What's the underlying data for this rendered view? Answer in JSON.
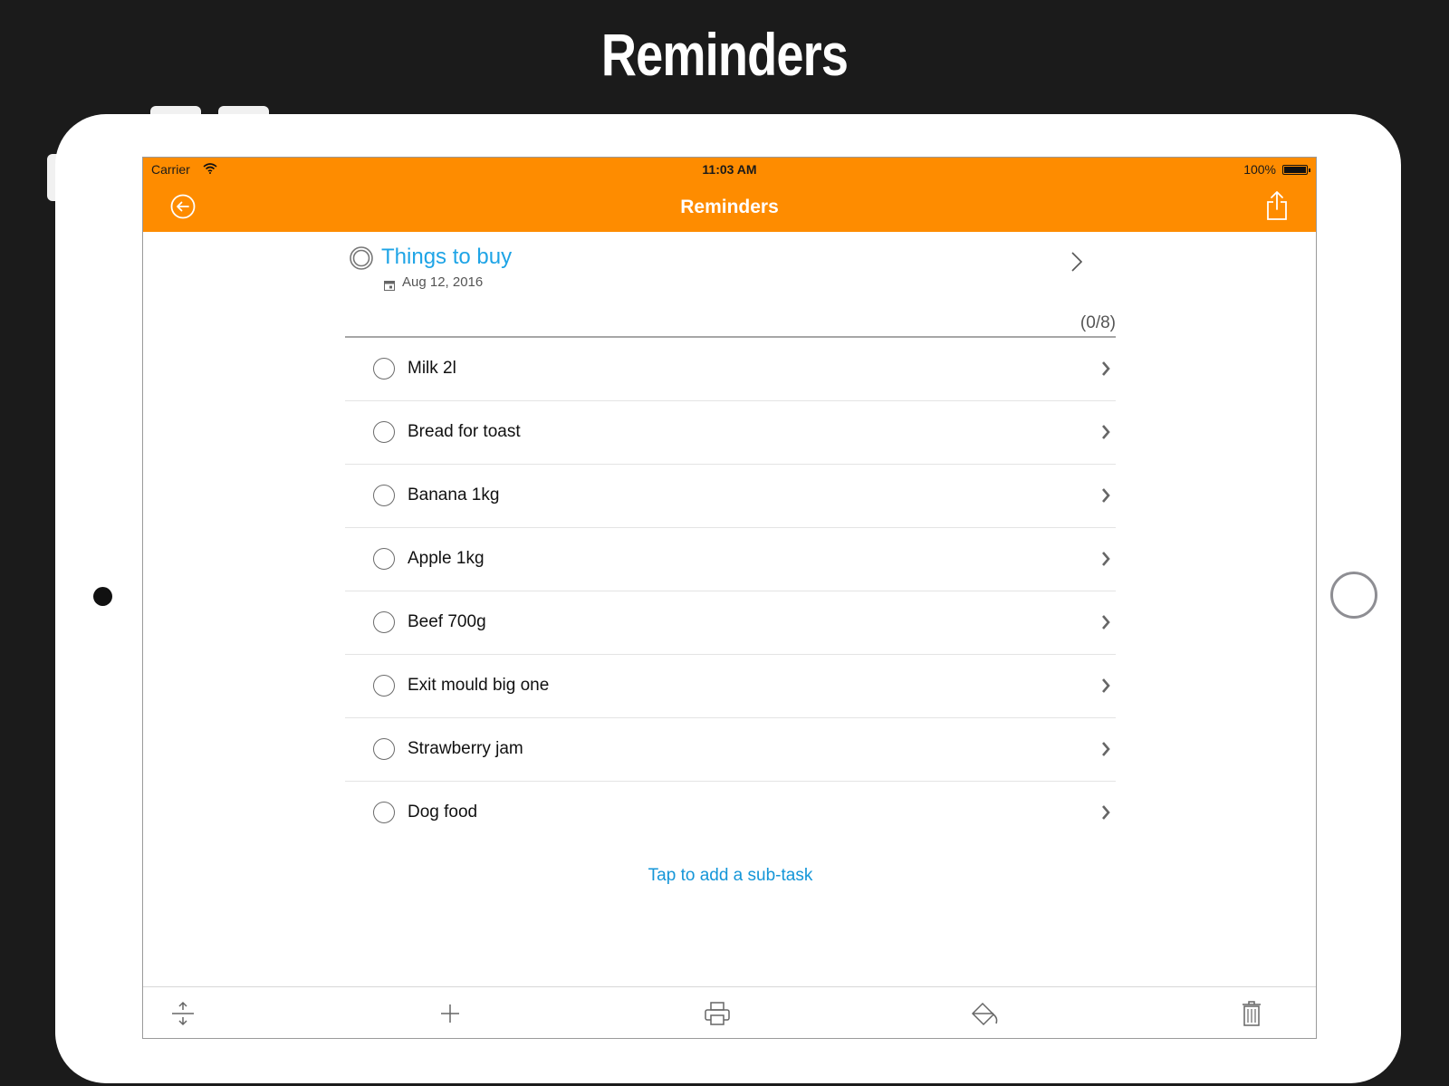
{
  "promo": {
    "title": "Reminders"
  },
  "status_bar": {
    "carrier": "Carrier",
    "time": "11:03 AM",
    "battery": "100%"
  },
  "nav": {
    "title": "Reminders"
  },
  "task": {
    "title": "Things to buy",
    "date": "Aug 12, 2016",
    "progress": "(0/8)"
  },
  "subtasks": [
    {
      "label": "Milk 2l"
    },
    {
      "label": "Bread for toast"
    },
    {
      "label": "Banana 1kg"
    },
    {
      "label": "Apple 1kg"
    },
    {
      "label": "Beef 700g"
    },
    {
      "label": "Exit mould big one"
    },
    {
      "label": "Strawberry jam"
    },
    {
      "label": "Dog food"
    }
  ],
  "add_subtask_label": "Tap to add a sub-task",
  "toolbar_icons": [
    "expand-collapse-icon",
    "plus-icon",
    "print-icon",
    "paint-bucket-icon",
    "trash-icon"
  ],
  "colors": {
    "accent": "#fe8c00",
    "link": "#1ea4e6",
    "background": "#1b1b1b"
  }
}
